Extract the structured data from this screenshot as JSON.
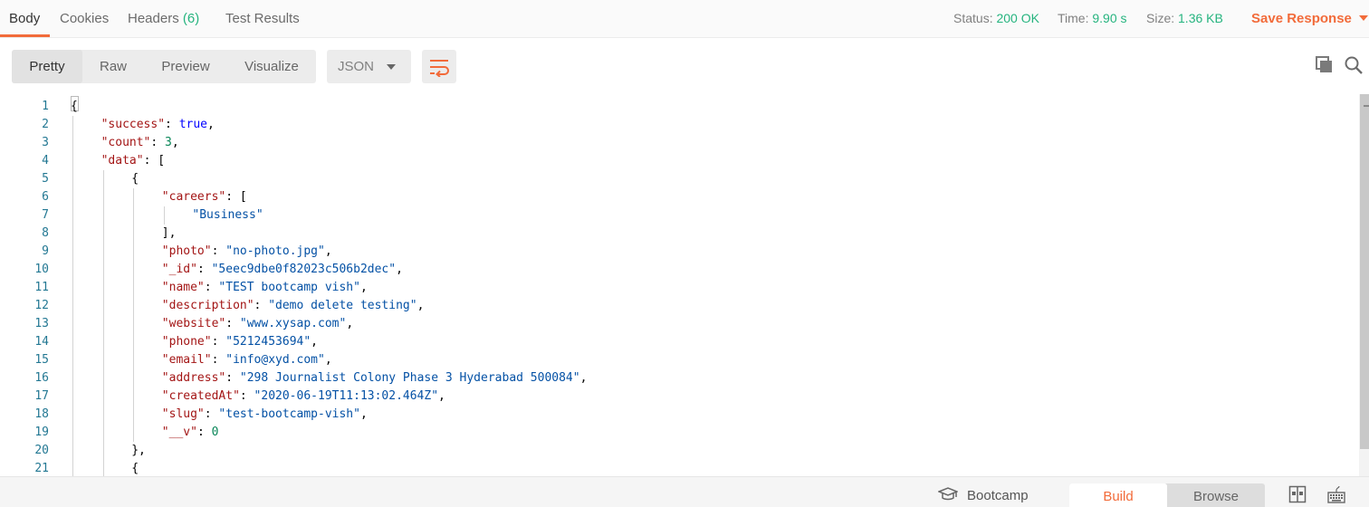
{
  "tabs": [
    {
      "label": "Body"
    },
    {
      "label": "Cookies"
    },
    {
      "label": "Headers",
      "count": "(6)"
    },
    {
      "label": "Test Results"
    }
  ],
  "response_meta": {
    "status_label": "Status:",
    "status_value": "200 OK",
    "time_label": "Time:",
    "time_value": "9.90 s",
    "size_label": "Size:",
    "size_value": "1.36 KB",
    "save_label": "Save Response"
  },
  "view_modes": [
    "Pretty",
    "Raw",
    "Preview",
    "Visualize"
  ],
  "active_view_mode": "Pretty",
  "format": "JSON",
  "icons": {
    "wrap": "wrap-lines-icon",
    "copy": "copy-icon",
    "search": "search-icon",
    "bootcamp": "graduation-cap-icon",
    "two_pane": "two-pane-icon",
    "keyboard": "keyboard-icon"
  },
  "colors": {
    "accent": "#f26b3a",
    "status_ok": "#26b47f",
    "json_key": "#a31515",
    "json_string": "#0451a5",
    "json_number": "#098658",
    "json_keyword": "#0000ff",
    "line_number": "#237893"
  },
  "editor": {
    "lines": [
      {
        "n": "1",
        "indent": 0,
        "tokens": [
          {
            "t": "p",
            "v": "{"
          }
        ]
      },
      {
        "n": "2",
        "indent": 1,
        "tokens": [
          {
            "t": "k",
            "v": "\"success\""
          },
          {
            "t": "p",
            "v": ": "
          },
          {
            "t": "b",
            "v": "true"
          },
          {
            "t": "p",
            "v": ","
          }
        ]
      },
      {
        "n": "3",
        "indent": 1,
        "tokens": [
          {
            "t": "k",
            "v": "\"count\""
          },
          {
            "t": "p",
            "v": ": "
          },
          {
            "t": "n",
            "v": "3"
          },
          {
            "t": "p",
            "v": ","
          }
        ]
      },
      {
        "n": "4",
        "indent": 1,
        "tokens": [
          {
            "t": "k",
            "v": "\"data\""
          },
          {
            "t": "p",
            "v": ": ["
          }
        ]
      },
      {
        "n": "5",
        "indent": 2,
        "tokens": [
          {
            "t": "p",
            "v": "{"
          }
        ]
      },
      {
        "n": "6",
        "indent": 3,
        "tokens": [
          {
            "t": "k",
            "v": "\"careers\""
          },
          {
            "t": "p",
            "v": ": ["
          }
        ]
      },
      {
        "n": "7",
        "indent": 4,
        "tokens": [
          {
            "t": "s",
            "v": "\"Business\""
          }
        ]
      },
      {
        "n": "8",
        "indent": 3,
        "tokens": [
          {
            "t": "p",
            "v": "],"
          }
        ]
      },
      {
        "n": "9",
        "indent": 3,
        "tokens": [
          {
            "t": "k",
            "v": "\"photo\""
          },
          {
            "t": "p",
            "v": ": "
          },
          {
            "t": "s",
            "v": "\"no-photo.jpg\""
          },
          {
            "t": "p",
            "v": ","
          }
        ]
      },
      {
        "n": "10",
        "indent": 3,
        "tokens": [
          {
            "t": "k",
            "v": "\"_id\""
          },
          {
            "t": "p",
            "v": ": "
          },
          {
            "t": "s",
            "v": "\"5eec9dbe0f82023c506b2dec\""
          },
          {
            "t": "p",
            "v": ","
          }
        ]
      },
      {
        "n": "11",
        "indent": 3,
        "tokens": [
          {
            "t": "k",
            "v": "\"name\""
          },
          {
            "t": "p",
            "v": ": "
          },
          {
            "t": "s",
            "v": "\"TEST bootcamp vish\""
          },
          {
            "t": "p",
            "v": ","
          }
        ]
      },
      {
        "n": "12",
        "indent": 3,
        "tokens": [
          {
            "t": "k",
            "v": "\"description\""
          },
          {
            "t": "p",
            "v": ": "
          },
          {
            "t": "s",
            "v": "\"demo delete testing\""
          },
          {
            "t": "p",
            "v": ","
          }
        ]
      },
      {
        "n": "13",
        "indent": 3,
        "tokens": [
          {
            "t": "k",
            "v": "\"website\""
          },
          {
            "t": "p",
            "v": ": "
          },
          {
            "t": "s",
            "v": "\"www.xysap.com\""
          },
          {
            "t": "p",
            "v": ","
          }
        ]
      },
      {
        "n": "14",
        "indent": 3,
        "tokens": [
          {
            "t": "k",
            "v": "\"phone\""
          },
          {
            "t": "p",
            "v": ": "
          },
          {
            "t": "s",
            "v": "\"5212453694\""
          },
          {
            "t": "p",
            "v": ","
          }
        ]
      },
      {
        "n": "15",
        "indent": 3,
        "tokens": [
          {
            "t": "k",
            "v": "\"email\""
          },
          {
            "t": "p",
            "v": ": "
          },
          {
            "t": "s",
            "v": "\"info@xyd.com\""
          },
          {
            "t": "p",
            "v": ","
          }
        ]
      },
      {
        "n": "16",
        "indent": 3,
        "tokens": [
          {
            "t": "k",
            "v": "\"address\""
          },
          {
            "t": "p",
            "v": ": "
          },
          {
            "t": "s",
            "v": "\"298 Journalist Colony Phase 3 Hyderabad 500084\""
          },
          {
            "t": "p",
            "v": ","
          }
        ]
      },
      {
        "n": "17",
        "indent": 3,
        "tokens": [
          {
            "t": "k",
            "v": "\"createdAt\""
          },
          {
            "t": "p",
            "v": ": "
          },
          {
            "t": "s",
            "v": "\"2020-06-19T11:13:02.464Z\""
          },
          {
            "t": "p",
            "v": ","
          }
        ]
      },
      {
        "n": "18",
        "indent": 3,
        "tokens": [
          {
            "t": "k",
            "v": "\"slug\""
          },
          {
            "t": "p",
            "v": ": "
          },
          {
            "t": "s",
            "v": "\"test-bootcamp-vish\""
          },
          {
            "t": "p",
            "v": ","
          }
        ]
      },
      {
        "n": "19",
        "indent": 3,
        "tokens": [
          {
            "t": "k",
            "v": "\"__v\""
          },
          {
            "t": "p",
            "v": ": "
          },
          {
            "t": "n",
            "v": "0"
          }
        ]
      },
      {
        "n": "20",
        "indent": 2,
        "tokens": [
          {
            "t": "p",
            "v": "},"
          }
        ]
      },
      {
        "n": "21",
        "indent": 2,
        "tokens": [
          {
            "t": "p",
            "v": "{"
          }
        ]
      }
    ]
  },
  "statusbar": {
    "bootcamp_label": "Bootcamp",
    "build_label": "Build",
    "browse_label": "Browse"
  }
}
